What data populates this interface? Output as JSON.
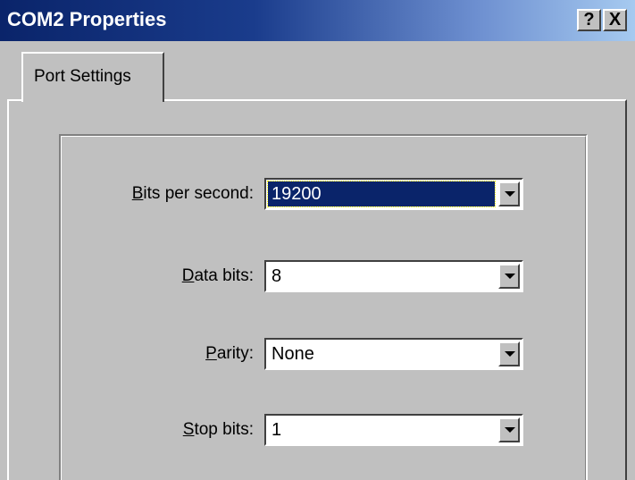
{
  "window": {
    "title": "COM2 Properties",
    "help_label": "?",
    "close_label": "X"
  },
  "tabs": [
    {
      "label": "Port Settings",
      "selected": true
    }
  ],
  "settings": {
    "bits_per_second": {
      "label_accel": "B",
      "label_rest": "its per second:",
      "value": "19200",
      "focused": true
    },
    "data_bits": {
      "label_accel": "D",
      "label_rest": "ata bits:",
      "value": "8"
    },
    "parity": {
      "label_accel": "P",
      "label_rest": "arity:",
      "value": "None"
    },
    "stop_bits": {
      "label_accel": "S",
      "label_rest": "top bits:",
      "value": "1"
    }
  },
  "colors": {
    "titlebar_start": "#0a246a",
    "titlebar_end": "#a6caf0",
    "face": "#c0c0c0",
    "selection": "#0a246a"
  },
  "icons": {
    "help": "help-icon",
    "close": "close-icon",
    "dropdown": "chevron-down-icon"
  }
}
